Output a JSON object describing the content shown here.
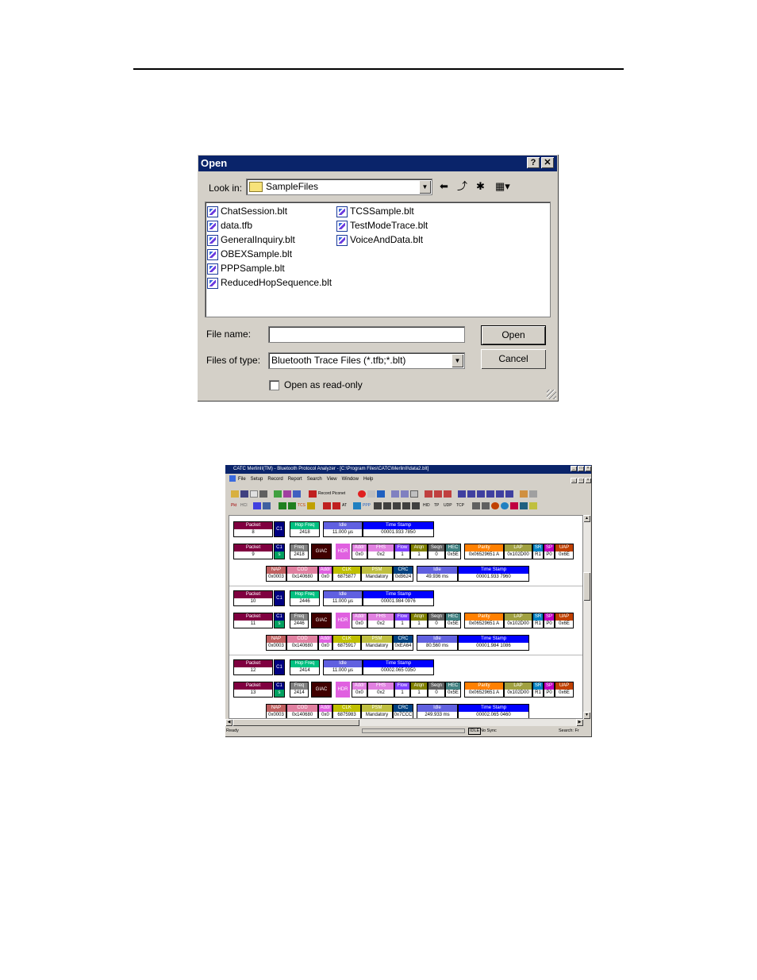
{
  "open_dialog": {
    "title": "Open",
    "help_btn": "?",
    "close_btn": "✕",
    "look_in_label": "Look in:",
    "look_in_value": "SampleFiles",
    "files": [
      "ChatSession.blt",
      "data.tfb",
      "GeneralInquiry.blt",
      "OBEXSample.blt",
      "PPPSample.blt",
      "ReducedHopSequence.blt",
      "TCSSample.blt",
      "TestModeTrace.blt",
      "VoiceAndData.blt"
    ],
    "filename_label": "File name:",
    "filename_value": "",
    "filetype_label": "Files of type:",
    "filetype_value": "Bluetooth Trace Files (*.tfb;*.blt)",
    "open_button": "Open",
    "cancel_button": "Cancel",
    "readonly_label": "Open as read-only",
    "readonly_checked": false
  },
  "merlin": {
    "title": "CATC MerlinII(TM) - Bluetooth Protocol Analyzer - [C:\\Program Files\\CATC\\MerlinII\\data2.blt]",
    "menu": [
      "File",
      "Setup",
      "Record",
      "Report",
      "Search",
      "View",
      "Window",
      "Help"
    ],
    "toolbar_record_label": "Record Piconet",
    "toolbar2_labels": [
      "Pkt",
      "HCI",
      "TCS",
      "AT",
      "PPP",
      "HID",
      "TP",
      "UDP",
      "TCP"
    ],
    "status_ready": "Ready",
    "status_idle": "IDLE",
    "status_sync": "No Sync",
    "status_search": "Search: Fr",
    "packets": [
      {
        "kind": "id",
        "packet": "8",
        "chan": "C1",
        "hopfreq": "2418",
        "idle": "11.000 µs",
        "timestamp": "00001.933 7850"
      },
      {
        "kind": "fhs",
        "packet": "9",
        "chan": "C1",
        "sub": "s",
        "freq": "2418",
        "giac": "GIAC",
        "hdr": "HDR",
        "addr": "0x0",
        "fhs": "0x2",
        "flow": "1",
        "arqn": "1",
        "seqn": "0",
        "hec": "0x5E",
        "parity": "0x06529651 A",
        "lap": "0x102D00",
        "sr": "R1",
        "sp": "P0",
        "uap": "0x6E",
        "nap": "0x0003",
        "cod": "0x140680",
        "am": "0x0",
        "clk": "6875877",
        "psm": "Mandatory",
        "crc": "0xB624",
        "idle2": "49.936 ms",
        "timestamp2": "00001.933 7960"
      },
      {
        "kind": "id",
        "packet": "10",
        "chan": "C1",
        "hopfreq": "2446",
        "idle": "11.000 µs",
        "timestamp": "00001.984 0976"
      },
      {
        "kind": "fhs",
        "packet": "11",
        "chan": "C1",
        "sub": "s",
        "freq": "2446",
        "giac": "GIAC",
        "hdr": "HDR",
        "addr": "0x0",
        "fhs": "0x2",
        "flow": "1",
        "arqn": "1",
        "seqn": "0",
        "hec": "0x5E",
        "parity": "0x06529651 A",
        "lap": "0x102D00",
        "sr": "R1",
        "sp": "P0",
        "uap": "0x6E",
        "nap": "0x0003",
        "cod": "0x140680",
        "am": "0x0",
        "clk": "6875917",
        "psm": "Mandatory",
        "crc": "0xEA64",
        "idle2": "80.560 ms",
        "timestamp2": "00001.984 1086"
      },
      {
        "kind": "id",
        "packet": "12",
        "chan": "C1",
        "hopfreq": "2414",
        "idle": "11.000 µs",
        "timestamp": "00002.065 0350"
      },
      {
        "kind": "fhs",
        "packet": "13",
        "chan": "C1",
        "sub": "s",
        "freq": "2414",
        "giac": "GIAC",
        "hdr": "HDR",
        "addr": "0x0",
        "fhs": "0x2",
        "flow": "1",
        "arqn": "1",
        "seqn": "0",
        "hec": "0x5E",
        "parity": "0x06529651 A",
        "lap": "0x102D00",
        "sr": "R1",
        "sp": "P0",
        "uap": "0x6E",
        "nap": "0x0003",
        "cod": "0x140680",
        "am": "0x0",
        "clk": "6875983",
        "psm": "Mandatory",
        "crc": "0x7CCC",
        "idle2": "249.933 ms",
        "timestamp2": "00002.065 0460"
      }
    ],
    "field_headers": {
      "packet": "Packet",
      "hopfreq": "Hop Freq",
      "freq": "Freq",
      "idle": "Idle",
      "timestamp": "Time Stamp",
      "addr": "Addr",
      "fhs": "FHS",
      "flow": "Flow",
      "arqn": "Arqn",
      "seqn": "Seqn",
      "hec": "HEC",
      "parity": "Parity",
      "lap": "LAP",
      "sr": "SR",
      "sp": "SP",
      "uap": "UAP",
      "nap": "NAP",
      "cod": "COD",
      "am": "Addr",
      "clk": "CLK",
      "psm": "PSM",
      "crc": "CRC"
    },
    "colors": {
      "packet": "#800040",
      "chan": "#000080",
      "hopfreq": "#00c080",
      "idle": "#6060e0",
      "timestamp": "#0000ff",
      "giac": "#400000",
      "hdr": "#e060e0",
      "addr": "#e080e0",
      "fhs": "#e080e0",
      "flow": "#8040ff",
      "arqn": "#808000",
      "seqn": "#606060",
      "hec": "#408080",
      "parity": "#ff8000",
      "lap": "#a0a040",
      "sr": "#0080c0",
      "sp": "#c000c0",
      "uap": "#c04000",
      "nap": "#c06060",
      "cod": "#e080a0",
      "am": "#e060e0",
      "clk": "#c0c000",
      "psm": "#c0c040",
      "crc": "#004080"
    }
  }
}
